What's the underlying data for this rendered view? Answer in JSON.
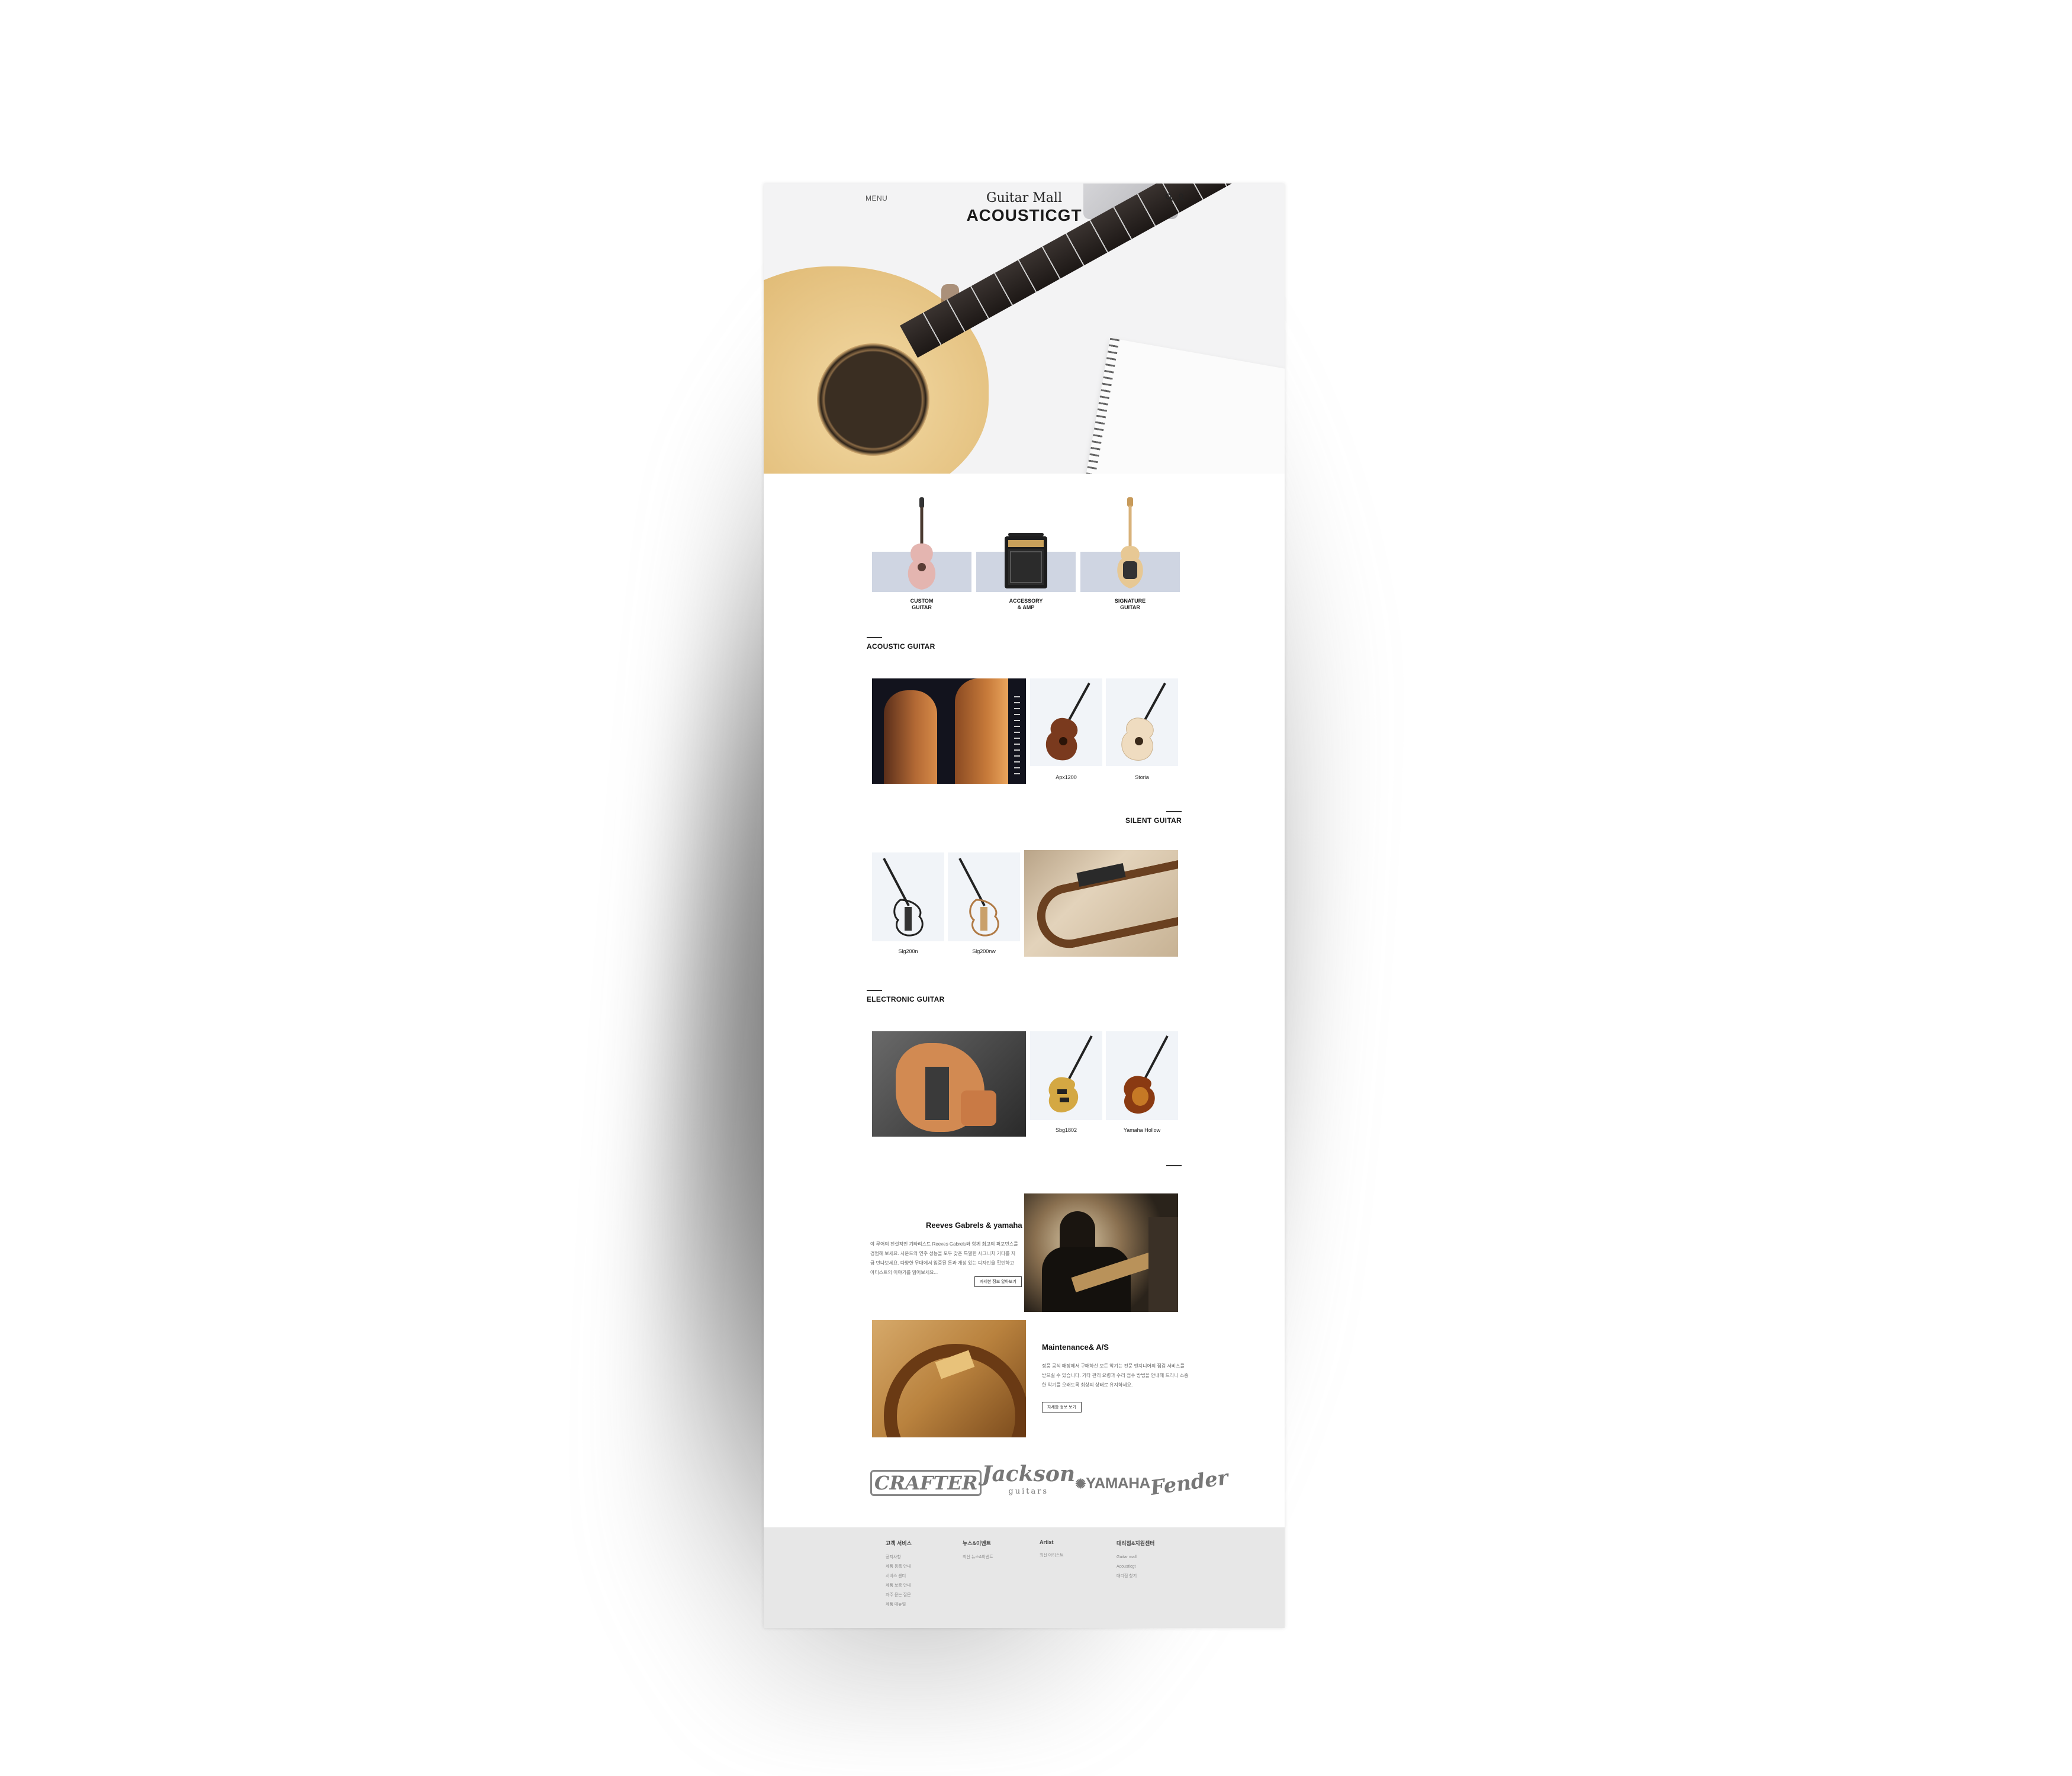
{
  "header": {
    "menu_label": "MENU",
    "brand_script": "Guitar Mall",
    "brand_title": "ACOUSTICGT",
    "icons": [
      "search-icon",
      "user-icon"
    ]
  },
  "categories": [
    {
      "label": "CUSTOM\nGUITAR",
      "icon": "acoustic-guitar-image"
    },
    {
      "label": "ACCESSORY\n& AMP",
      "icon": "amp-image"
    },
    {
      "label": "SIGNATURE\nGUITAR",
      "icon": "electric-guitar-image"
    }
  ],
  "sections": {
    "acoustic": {
      "title": "ACOUSTIC GUITAR",
      "products": [
        {
          "name": "Apx1200"
        },
        {
          "name": "Storia"
        }
      ]
    },
    "silent": {
      "title": "SILENT GUITAR",
      "products": [
        {
          "name": "Slg200n"
        },
        {
          "name": "Slg200nw"
        }
      ]
    },
    "electronic": {
      "title": "ELECTRONIC GUITAR",
      "products": [
        {
          "name": "Sbg1802"
        },
        {
          "name": "Yamaha Hollow"
        }
      ]
    }
  },
  "features": [
    {
      "title": "Reeves Gabrels & yamaha",
      "body": "야 루어의 전설적인 기타리스트 Reeves Gabrels와 함께 최고의 퍼포먼스를 경험해 보세요. 사운드와 연주 성능을 모두 갖춘 특별한 시그니처 기타를 지금 만나보세요. 다양한 무대에서 입증된 톤과 개성 있는 디자인을 확인하고 아티스트의 이야기를 읽어보세요...",
      "button": "자세한 정보 알아보기"
    },
    {
      "title": "Maintenance& A/S",
      "body": "정품 공식 매장에서 구매하신 모든 악기는 전문 엔지니어의 점검 서비스를 받으실 수 있습니다. 기타 관리 요령과 수리 접수 방법을 안내해 드리니 소중한 악기를 오래도록 최상의 상태로 유지하세요.",
      "button": "자세한 정보 보기"
    }
  ],
  "brands": {
    "crafter": "CRAFTER",
    "jackson": "Jackson",
    "jackson_sub": "guitars",
    "yamaha": "YAMAHA",
    "fender": "Fender"
  },
  "footer": {
    "columns": [
      {
        "heading": "고객 서비스",
        "items": [
          "공지사항",
          "제품 등록 안내",
          "서비스 센터",
          "제품 보증 안내",
          "자주 묻는 질문",
          "제품 매뉴얼"
        ]
      },
      {
        "heading": "뉴스&이벤트",
        "items": [
          "최신 뉴스&이벤트"
        ]
      },
      {
        "heading": "Artist",
        "items": [
          "최신 아티스트"
        ]
      },
      {
        "heading": "대리점&지원센터",
        "items": [
          "Guitar mall",
          "Acousticgt",
          "대리점 찾기"
        ]
      }
    ]
  },
  "colors": {
    "category_bg": "#cfd5e2",
    "tile_bg": "#f1f4f8",
    "footer_bg": "#e7e7e7"
  }
}
